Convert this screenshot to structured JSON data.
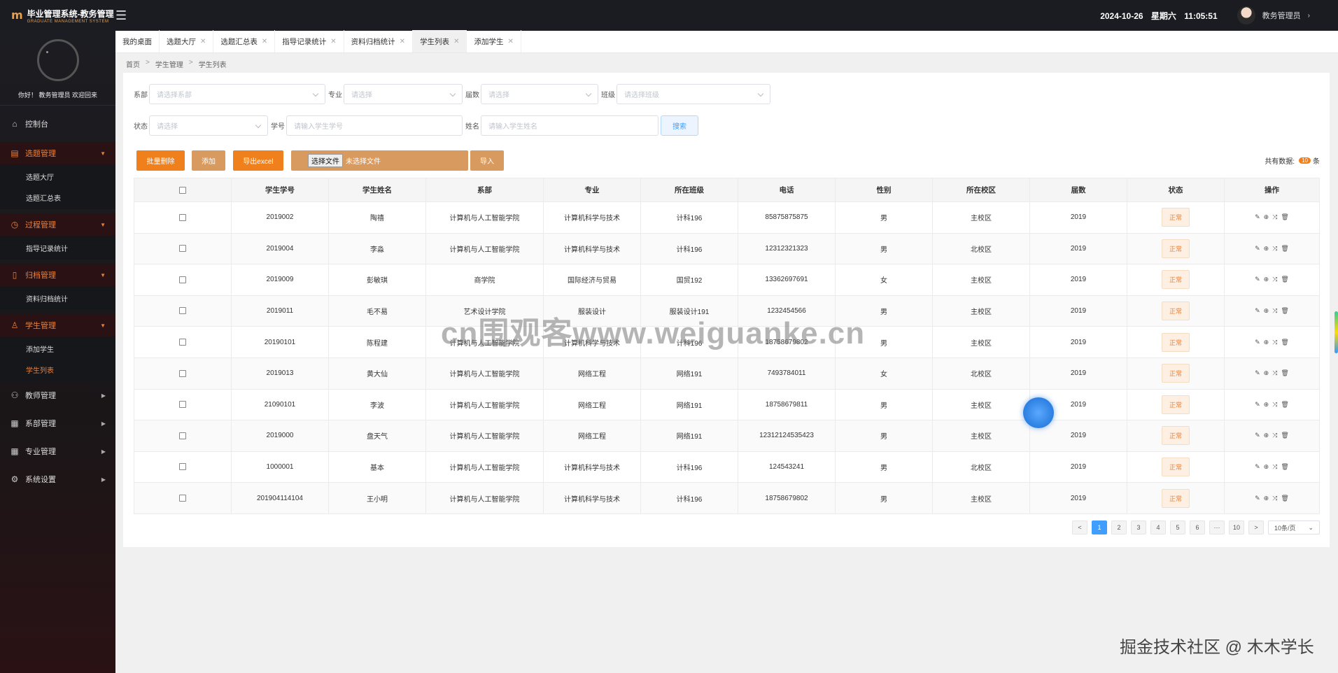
{
  "header": {
    "logo_title": "毕业管理系统-教务管理",
    "logo_sub": "GRADUATE MANAGEMENT SYSTEM",
    "date": "2024-10-26",
    "weekday": "星期六",
    "time": "11:05:51",
    "user": "教务管理员"
  },
  "sidebar": {
    "welcome": "你好！ 教务管理员 欢迎回来",
    "items": [
      {
        "label": "控制台"
      },
      {
        "label": "选题管理",
        "subs": [
          "选题大厅",
          "选题汇总表"
        ]
      },
      {
        "label": "过程管理",
        "subs": [
          "指导记录统计"
        ]
      },
      {
        "label": "归档管理",
        "subs": [
          "资料归档统计"
        ]
      },
      {
        "label": "学生管理",
        "subs": [
          "添加学生",
          "学生列表"
        ]
      },
      {
        "label": "教师管理"
      },
      {
        "label": "系部管理"
      },
      {
        "label": "专业管理"
      },
      {
        "label": "系统设置"
      }
    ]
  },
  "tabs": [
    "我的桌面",
    "选题大厅",
    "选题汇总表",
    "指导记录统计",
    "资料归档统计",
    "学生列表",
    "添加学生"
  ],
  "breadcrumb": [
    "首页",
    "学生管理",
    "学生列表"
  ],
  "filters": {
    "dept_label": "系部",
    "dept_placeholder": "请选择系部",
    "major_label": "专业",
    "major_placeholder": "请选择",
    "year_label": "届数",
    "year_placeholder": "请选择",
    "class_label": "班级",
    "class_placeholder": "请选择班级",
    "status_label": "状态",
    "status_placeholder": "请选择",
    "sid_label": "学号",
    "sid_placeholder": "请输入学生学号",
    "name_label": "姓名",
    "name_placeholder": "请输入学生姓名",
    "search_label": "搜索"
  },
  "toolbar": {
    "batch_delete": "批量删除",
    "add": "添加",
    "export": "导出excel",
    "choose_file": "选择文件",
    "no_file": "未选择文件",
    "import": "导入",
    "total_label": "共有数据:",
    "total_count": "10",
    "total_unit": "条"
  },
  "table": {
    "headers": [
      "学生学号",
      "学生姓名",
      "系部",
      "专业",
      "所在班级",
      "电话",
      "性别",
      "所在校区",
      "届数",
      "状态",
      "操作"
    ],
    "rows": [
      [
        "2019002",
        "陶禧",
        "计算机与人工智能学院",
        "计算机科学与技术",
        "计科196",
        "85875875875",
        "男",
        "主校区",
        "2019",
        "正常"
      ],
      [
        "2019004",
        "李淼",
        "计算机与人工智能学院",
        "计算机科学与技术",
        "计科196",
        "12312321323",
        "男",
        "北校区",
        "2019",
        "正常"
      ],
      [
        "2019009",
        "彭敏琪",
        "商学院",
        "国际经济与贸易",
        "国贸192",
        "13362697691",
        "女",
        "主校区",
        "2019",
        "正常"
      ],
      [
        "2019011",
        "毛不易",
        "艺术设计学院",
        "服装设计",
        "服装设计191",
        "1232454566",
        "男",
        "主校区",
        "2019",
        "正常"
      ],
      [
        "20190101",
        "陈程建",
        "计算机与人工智能学院",
        "计算机科学与技术",
        "计科196",
        "18758679802",
        "男",
        "主校区",
        "2019",
        "正常"
      ],
      [
        "2019013",
        "黄大仙",
        "计算机与人工智能学院",
        "网络工程",
        "网络191",
        "7493784011",
        "女",
        "北校区",
        "2019",
        "正常"
      ],
      [
        "21090101",
        "李波",
        "计算机与人工智能学院",
        "网络工程",
        "网络191",
        "18758679811",
        "男",
        "主校区",
        "2019",
        "正常"
      ],
      [
        "2019000",
        "盘天气",
        "计算机与人工智能学院",
        "网络工程",
        "网络191",
        "12312124535423",
        "男",
        "主校区",
        "2019",
        "正常"
      ],
      [
        "1000001",
        "基本",
        "计算机与人工智能学院",
        "计算机科学与技术",
        "计科196",
        "124543241",
        "男",
        "北校区",
        "2019",
        "正常"
      ],
      [
        "201904114104",
        "王小明",
        "计算机与人工智能学院",
        "计算机科学与技术",
        "计科196",
        "18758679802",
        "男",
        "主校区",
        "2019",
        "正常"
      ]
    ]
  },
  "pagination": {
    "prev": "<",
    "next": ">",
    "pages": [
      "1",
      "2",
      "3",
      "4",
      "5",
      "6",
      "···",
      "10"
    ],
    "current": "1",
    "page_size": "10条/页"
  },
  "overlay": {
    "watermark": "cn围观客www.weiguanke.cn",
    "footer_mark": "掘金技术社区 @ 木木学长"
  }
}
